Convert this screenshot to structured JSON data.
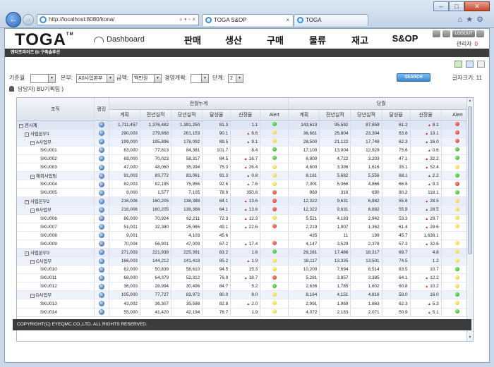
{
  "browser": {
    "url": "http://localhost:8080/kona/",
    "addr_tools": "⌕ ▾ ⌁ ×",
    "tabs": [
      {
        "label": "TOGA S&OP",
        "close": "×"
      },
      {
        "label": "TOGA"
      }
    ],
    "window_buttons": [
      "–",
      "□",
      "✕"
    ]
  },
  "app": {
    "logo": "TOGA",
    "logo_tm": "TM",
    "dashboard": "Dashboard",
    "menu": [
      "판매",
      "생산",
      "구매",
      "물류",
      "재고",
      "S&OP"
    ],
    "logout": "LOGOUT",
    "admin": "관리자",
    "admin_count": "0",
    "subtitle": "엔터프라이즈 BI 구축솔루션"
  },
  "filters": {
    "base_label": "기준월",
    "hq_label": "본부:",
    "hq_value": "A0사업본부",
    "amount_label": "금액:",
    "amount_value": "백만원",
    "plan_label": "경영계획:",
    "level_label": "단계:",
    "level_value": "2",
    "search": "SEARCH",
    "font_size_label": "글자크기: 11",
    "team": "담당자) BU기획팀 )"
  },
  "table": {
    "headers": {
      "org": "조직",
      "rank": "랭킹",
      "cum": "전월누계",
      "cur": "당월",
      "cols": [
        "계획",
        "전년실적",
        "당년실적",
        "달성율",
        "신장율",
        "Alert"
      ]
    },
    "rows": [
      {
        "level": "top",
        "name": "전사계",
        "v": [
          "1,711,457",
          "1,376,482",
          "1,391,250",
          "81.3",
          "1.1"
        ],
        "u1": false,
        "a1": "green",
        "w": [
          "143,613",
          "95,592",
          "87,859",
          "61.2",
          "8.1"
        ],
        "u2": true,
        "a2": "red"
      },
      {
        "level": "div",
        "name": "사업본부1",
        "v": [
          "290,003",
          "279,668",
          "261,153",
          "90.1",
          "6.6"
        ],
        "u1": true,
        "a1": "yellow",
        "w": [
          "36,661",
          "26,804",
          "23,304",
          "63.6",
          "13.1"
        ],
        "u2": true,
        "a2": "red"
      },
      {
        "level": "team",
        "name": "A사업부",
        "v": [
          "199,000",
          "195,896",
          "178,092",
          "89.5",
          "9.1"
        ],
        "u1": true,
        "a1": "yellow",
        "w": [
          "28,500",
          "21,122",
          "17,748",
          "62.3",
          "16.0"
        ],
        "u2": true,
        "a2": "red"
      },
      {
        "level": "sku",
        "name": "SKU001",
        "v": [
          "83,000",
          "77,813",
          "84,381",
          "101.7",
          "8.4"
        ],
        "u1": false,
        "a1": "green",
        "w": [
          "17,100",
          "13,004",
          "12,929",
          "75.6",
          "0.6"
        ],
        "u2": true,
        "a2": "green"
      },
      {
        "level": "sku",
        "name": "SKU002",
        "v": [
          "69,000",
          "70,023",
          "58,317",
          "84.5",
          "16.7"
        ],
        "u1": true,
        "a1": "green",
        "w": [
          "6,800",
          "4,722",
          "3,203",
          "47.1",
          "32.2"
        ],
        "u2": true,
        "a2": "green"
      },
      {
        "level": "sku",
        "name": "SKU003",
        "v": [
          "47,000",
          "48,060",
          "35,394",
          "75.3",
          "26.4"
        ],
        "u1": true,
        "a1": "yellow",
        "w": [
          "4,600",
          "3,396",
          "1,616",
          "35.1",
          "52.4"
        ],
        "u2": true,
        "a2": "yellow"
      },
      {
        "level": "team",
        "name": "해외사업팀",
        "v": [
          "91,003",
          "83,772",
          "83,061",
          "91.3",
          "0.8"
        ],
        "u1": true,
        "a1": "yellow",
        "w": [
          "8,161",
          "5,682",
          "5,556",
          "68.1",
          "2.2"
        ],
        "u2": true,
        "a2": "green"
      },
      {
        "level": "sku",
        "name": "SKU004",
        "v": [
          "82,003",
          "82,195",
          "75,956",
          "92.6",
          "7.6"
        ],
        "u1": true,
        "a1": "yellow",
        "w": [
          "7,301",
          "5,366",
          "4,866",
          "66.6",
          "9.3"
        ],
        "u2": true,
        "a2": "red"
      },
      {
        "level": "sku",
        "name": "SKU005",
        "v": [
          "9,000",
          "1,577",
          "7,105",
          "78.9",
          "350.6"
        ],
        "u1": false,
        "a1": "red",
        "w": [
          "860",
          "316",
          "690",
          "80.2",
          "118.1"
        ],
        "u2": false,
        "a2": "green"
      },
      {
        "level": "div",
        "name": "사업본부2",
        "v": [
          "216,006",
          "160,205",
          "138,388",
          "64.1",
          "13.6"
        ],
        "u1": true,
        "a1": "red",
        "w": [
          "12,322",
          "9,631",
          "6,882",
          "55.8",
          "28.5"
        ],
        "u2": true,
        "a2": "yellow"
      },
      {
        "level": "team",
        "name": "B사업부",
        "v": [
          "216,006",
          "160,205",
          "138,388",
          "64.1",
          "13.6"
        ],
        "u1": true,
        "a1": "red",
        "w": [
          "12,322",
          "9,631",
          "6,882",
          "55.8",
          "28.5"
        ],
        "u2": true,
        "a2": "yellow"
      },
      {
        "level": "sku",
        "name": "SKU006",
        "v": [
          "86,000",
          "70,924",
          "62,211",
          "72.3",
          "12.3"
        ],
        "u1": true,
        "a1": "yellow",
        "w": [
          "5,521",
          "4,183",
          "2,942",
          "53.3",
          "29.7"
        ],
        "u2": true,
        "a2": "yellow"
      },
      {
        "level": "sku",
        "name": "SKU007",
        "v": [
          "51,001",
          "32,380",
          "25,065",
          "49.1",
          "22.6"
        ],
        "u1": true,
        "a1": "red",
        "w": [
          "2,219",
          "1,907",
          "1,362",
          "61.4",
          "28.6"
        ],
        "u2": true,
        "a2": "yellow"
      },
      {
        "level": "sku",
        "name": "SKU008",
        "v": [
          "9,001",
          "",
          "4,103",
          "45.6",
          ""
        ],
        "u1": false,
        "a1": "",
        "w": [
          "435",
          "11",
          "199",
          "45.7",
          "1,638.1"
        ],
        "u2": false,
        "a2": ""
      },
      {
        "level": "sku",
        "name": "SKU009",
        "v": [
          "70,004",
          "56,901",
          "47,009",
          "67.2",
          "17.4"
        ],
        "u1": true,
        "a1": "red",
        "w": [
          "4,147",
          "3,529",
          "2,378",
          "57.3",
          "32.6"
        ],
        "u2": true,
        "a2": "yellow"
      },
      {
        "level": "div",
        "name": "사업본부3",
        "v": [
          "271,003",
          "221,938",
          "225,391",
          "83.2",
          "1.6"
        ],
        "u1": false,
        "a1": "green",
        "w": [
          "26,281",
          "17,486",
          "18,317",
          "69.7",
          "4.8"
        ],
        "u2": false,
        "a2": "yellow"
      },
      {
        "level": "team",
        "name": "C사업부",
        "v": [
          "166,003",
          "144,212",
          "141,418",
          "85.2",
          "1.9"
        ],
        "u1": true,
        "a1": "yellow",
        "w": [
          "18,117",
          "13,335",
          "13,501",
          "74.5",
          "1.2"
        ],
        "u2": false,
        "a2": "yellow"
      },
      {
        "level": "sku",
        "name": "SKU010",
        "v": [
          "62,000",
          "50,839",
          "58,610",
          "94.5",
          "15.3"
        ],
        "u1": false,
        "a1": "yellow",
        "w": [
          "10,200",
          "7,694",
          "8,514",
          "83.5",
          "10.7"
        ],
        "u2": false,
        "a2": "green"
      },
      {
        "level": "sku",
        "name": "SKU011",
        "v": [
          "68,000",
          "64,379",
          "52,312",
          "76.9",
          "18.7"
        ],
        "u1": true,
        "a1": "red",
        "w": [
          "5,281",
          "3,857",
          "3,385",
          "64.1",
          "12.2"
        ],
        "u2": true,
        "a2": "yellow"
      },
      {
        "level": "sku",
        "name": "SKU012",
        "v": [
          "36,003",
          "28,994",
          "30,496",
          "84.7",
          "5.2"
        ],
        "u1": false,
        "a1": "green",
        "w": [
          "2,636",
          "1,785",
          "1,602",
          "60.8",
          "10.2"
        ],
        "u2": true,
        "a2": "yellow"
      },
      {
        "level": "team",
        "name": "D사업부",
        "v": [
          "105,000",
          "77,727",
          "83,972",
          "80.0",
          "8.0"
        ],
        "u1": false,
        "a1": "yellow",
        "w": [
          "8,164",
          "4,151",
          "4,816",
          "59.0",
          "16.0"
        ],
        "u2": false,
        "a2": "green"
      },
      {
        "level": "sku",
        "name": "SKU013",
        "v": [
          "43,002",
          "36,307",
          "35,598",
          "82.8",
          "2.0"
        ],
        "u1": true,
        "a1": "yellow",
        "w": [
          "2,991",
          "1,969",
          "1,863",
          "62.3",
          "5.3"
        ],
        "u2": true,
        "a2": "yellow"
      },
      {
        "level": "sku",
        "name": "SKU014",
        "v": [
          "55,000",
          "41,420",
          "42,194",
          "76.7",
          "1.9"
        ],
        "u1": false,
        "a1": "yellow",
        "w": [
          "4,072",
          "2,183",
          "2,071",
          "50.9",
          "5.1"
        ],
        "u2": true,
        "a2": "green"
      }
    ],
    "rank_badge": "R"
  },
  "footer": "COPYRIGHT(C) EYEQMC.CO.,LTD. ALL RIGHTS RESERVED."
}
